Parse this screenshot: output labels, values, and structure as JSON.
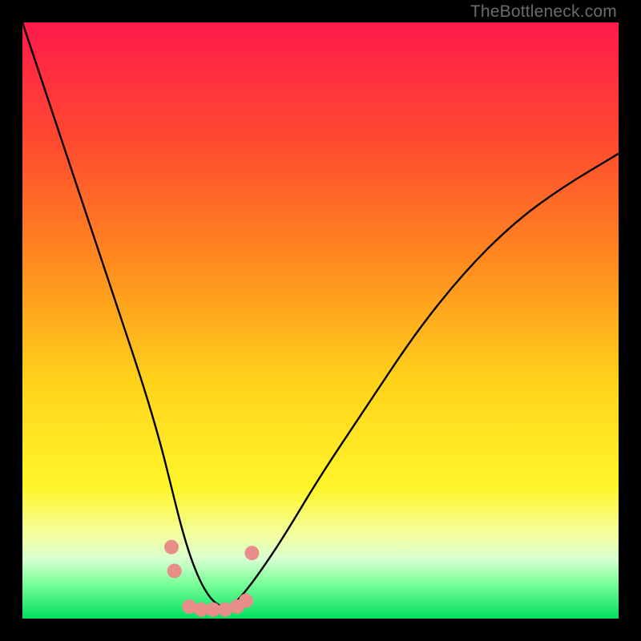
{
  "watermark": "TheBottleneck.com",
  "chart_data": {
    "type": "line",
    "title": "",
    "xlabel": "",
    "ylabel": "",
    "xlim": [
      0,
      100
    ],
    "ylim": [
      0,
      100
    ],
    "gradient_stops": [
      {
        "offset": 0,
        "color": "#ff1a4b"
      },
      {
        "offset": 20,
        "color": "#ff4a2f"
      },
      {
        "offset": 40,
        "color": "#ff8a1f"
      },
      {
        "offset": 60,
        "color": "#ffd21a"
      },
      {
        "offset": 78,
        "color": "#fff62a"
      },
      {
        "offset": 86,
        "color": "#f3ffa0"
      },
      {
        "offset": 90,
        "color": "#d8ffd0"
      },
      {
        "offset": 94,
        "color": "#7dff9a"
      },
      {
        "offset": 100,
        "color": "#00e060"
      }
    ],
    "curve": {
      "x": [
        0,
        4,
        8,
        12,
        16,
        20,
        23,
        25,
        27,
        29,
        31,
        33,
        35,
        37,
        40,
        44,
        50,
        58,
        66,
        74,
        82,
        90,
        100
      ],
      "y": [
        100,
        88,
        76,
        64,
        52,
        40,
        30,
        22,
        14,
        8,
        4,
        2,
        2,
        4,
        8,
        14,
        24,
        36,
        48,
        58,
        66,
        72,
        78
      ]
    },
    "markers": {
      "color": "#e98d89",
      "radius": 9,
      "points": [
        {
          "x": 25.0,
          "y": 12.0
        },
        {
          "x": 25.5,
          "y": 8.0
        },
        {
          "x": 28.0,
          "y": 2.0
        },
        {
          "x": 30.0,
          "y": 1.5
        },
        {
          "x": 32.0,
          "y": 1.5
        },
        {
          "x": 34.0,
          "y": 1.5
        },
        {
          "x": 36.0,
          "y": 2.0
        },
        {
          "x": 37.5,
          "y": 3.0
        },
        {
          "x": 38.5,
          "y": 11.0
        }
      ]
    }
  }
}
